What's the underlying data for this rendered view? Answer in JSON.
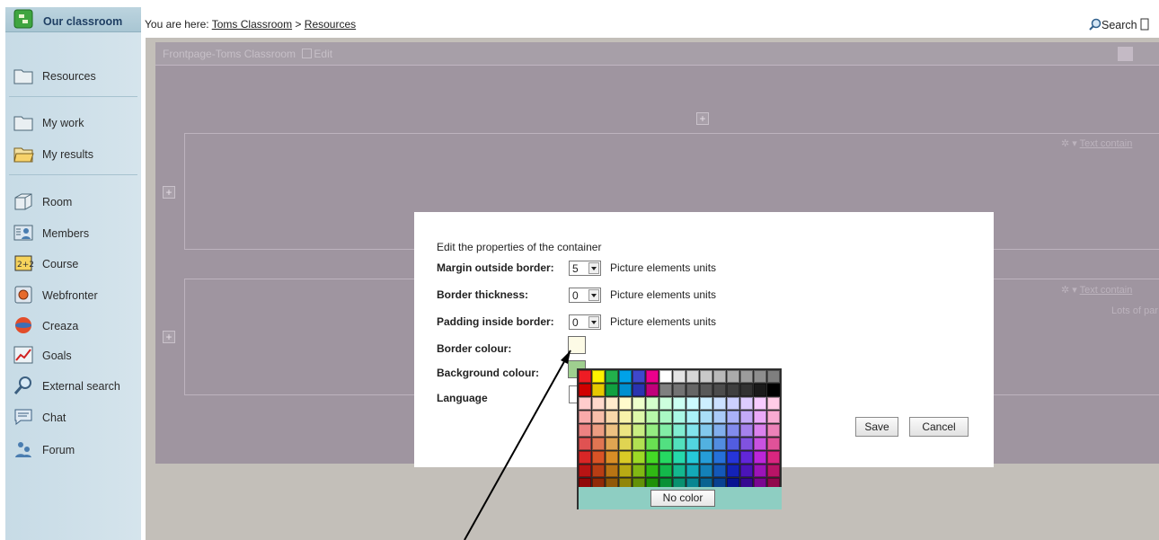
{
  "sidebar": {
    "header_label": "Our classroom",
    "items": [
      {
        "label": "Resources",
        "icon": "folder-icon"
      },
      {
        "label": "My work",
        "icon": "folder-icon"
      },
      {
        "label": "My results",
        "icon": "open-folder-icon"
      },
      {
        "label": "Room",
        "icon": "room-icon"
      },
      {
        "label": "Members",
        "icon": "members-icon"
      },
      {
        "label": "Course",
        "icon": "course-icon"
      },
      {
        "label": "Webfronter",
        "icon": "webfronter-icon"
      },
      {
        "label": "Creaza",
        "icon": "creaza-icon"
      },
      {
        "label": "Goals",
        "icon": "goals-chart-icon"
      },
      {
        "label": "External search",
        "icon": "magnifier-icon"
      },
      {
        "label": "Chat",
        "icon": "chat-icon"
      },
      {
        "label": "Forum",
        "icon": "forum-icon"
      }
    ]
  },
  "breadcrumb": {
    "prefix": "You are here: ",
    "crumb1": "Toms Classroom",
    "separator": " > ",
    "crumb2": "Resources"
  },
  "search_label": "Search",
  "page": {
    "panel_title": "Frontpage-Toms Classroom",
    "edit_label": "Edit",
    "container_label": "Text contain",
    "container_label2": "Text contain",
    "container_snippet": "Lots of par"
  },
  "dialog": {
    "title": "Edit the properties of the container",
    "margin_label": "Margin outside border:",
    "margin_value": "5",
    "thickness_label": "Border thickness:",
    "thickness_value": "0",
    "padding_label": "Padding inside border:",
    "padding_value": "0",
    "unit_text": "Picture elements units",
    "border_colour_label": "Border colour:",
    "background_colour_label": "Background colour:",
    "language_label": "Language",
    "save_label": "Save",
    "cancel_label": "Cancel",
    "border_colour_value": "#fdfbe6",
    "background_colour_value": "#9fcf8f"
  },
  "picker": {
    "no_color_label": "No color",
    "top_colors": [
      "#ee1c24",
      "#fff200",
      "#22b14c",
      "#00a2e8",
      "#3f48cc",
      "#ec008c",
      "#ffffff",
      "#e4e4e4",
      "#d6d6d6",
      "#c8c8c8",
      "#b9b9b9",
      "#ababab",
      "#9c9c9c",
      "#8e8e8e",
      "#7f7f7f"
    ],
    "second_colors": [
      "#d00000",
      "#e6c800",
      "#11a040",
      "#0090d0",
      "#2a34b0",
      "#c0007a",
      "#808080",
      "#737373",
      "#666666",
      "#595959",
      "#4c4c4c",
      "#3f3f3f",
      "#323232",
      "#1a1a1a",
      "#000000"
    ]
  }
}
